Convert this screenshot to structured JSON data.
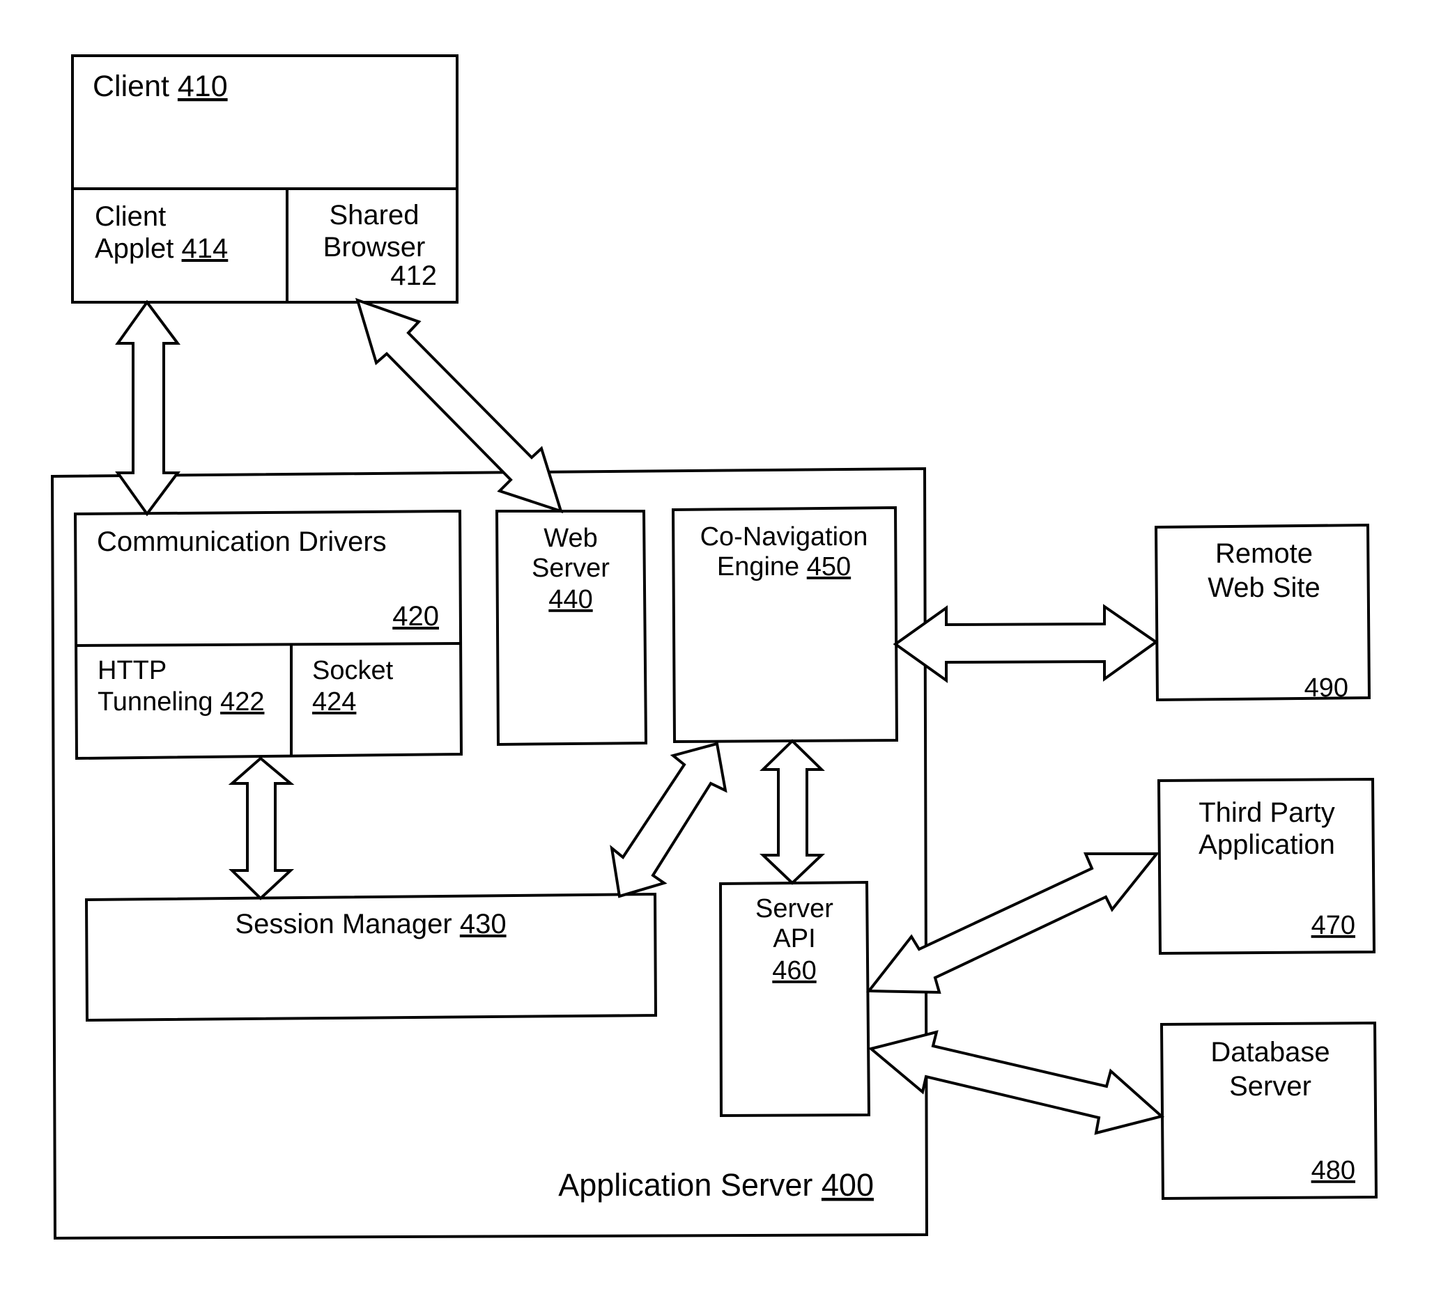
{
  "diagram": {
    "type": "system-architecture",
    "line_color": "#000000",
    "background": "#ffffff",
    "components": {
      "client": {
        "name": "Client",
        "ref": "410"
      },
      "client_applet": {
        "line1": "Client",
        "line2": "Applet",
        "ref": "414"
      },
      "shared_browser": {
        "line1": "Shared",
        "line2": "Browser",
        "ref": "412"
      },
      "application_server": {
        "name": "Application Server",
        "ref": "400"
      },
      "communication_drivers": {
        "name": "Communication Drivers",
        "ref": "420"
      },
      "http_tunneling": {
        "line1": "HTTP",
        "line2": "Tunneling",
        "ref": "422"
      },
      "socket": {
        "line1": "Socket",
        "ref": "424"
      },
      "web_server": {
        "line1": "Web",
        "line2": "Server",
        "ref": "440"
      },
      "co_navigation_engine": {
        "line1": "Co-Navigation",
        "line2": "Engine",
        "ref": "450"
      },
      "session_manager": {
        "name": "Session Manager",
        "ref": "430"
      },
      "server_api": {
        "line1": "Server",
        "line2": "API",
        "ref": "460"
      },
      "remote_web_site": {
        "line1": "Remote",
        "line2": "Web Site",
        "ref": "490"
      },
      "third_party_application": {
        "line1": "Third Party",
        "line2": "Application",
        "ref": "470"
      },
      "database_server": {
        "line1": "Database",
        "line2": "Server",
        "ref": "480"
      }
    },
    "connections": [
      {
        "from": "client_applet",
        "to": "communication_drivers",
        "direction": "bidirectional"
      },
      {
        "from": "shared_browser",
        "to": "web_server",
        "direction": "bidirectional"
      },
      {
        "from": "communication_drivers",
        "to": "session_manager",
        "direction": "bidirectional"
      },
      {
        "from": "session_manager",
        "to": "co_navigation_engine",
        "direction": "bidirectional"
      },
      {
        "from": "co_navigation_engine",
        "to": "server_api",
        "direction": "bidirectional"
      },
      {
        "from": "co_navigation_engine",
        "to": "remote_web_site",
        "direction": "bidirectional"
      },
      {
        "from": "server_api",
        "to": "third_party_application",
        "direction": "bidirectional"
      },
      {
        "from": "server_api",
        "to": "database_server",
        "direction": "bidirectional"
      }
    ]
  }
}
